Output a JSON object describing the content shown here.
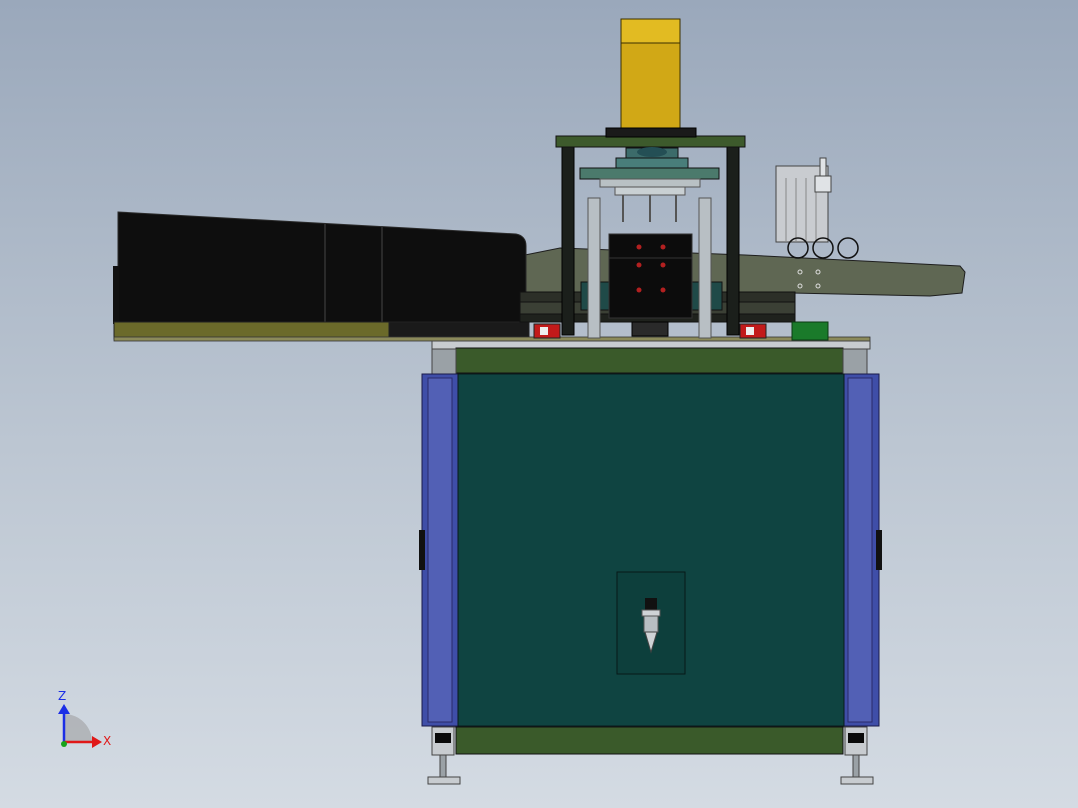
{
  "viewport": {
    "triad": {
      "z_label": "Z",
      "x_label": "X",
      "colors": {
        "z": "#1b2ee6",
        "x": "#e01818",
        "y": "#17a21a"
      }
    }
  },
  "colors": {
    "background_top": "#9aa8bb",
    "background_bottom": "#d4dbe3",
    "cabinet_panel": "#0f4441",
    "frame_olive": "#2f4f27",
    "side_panel_blue": "#3f4ea8",
    "motor_yellow": "#d1a816",
    "conveyor_black": "#111111",
    "rail_olive": "#6b6a2a",
    "chute_gray": "#606852"
  }
}
